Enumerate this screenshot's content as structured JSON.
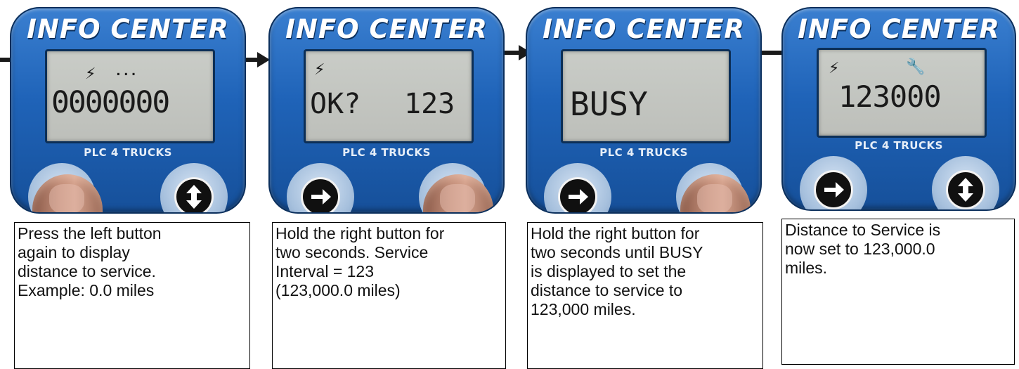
{
  "device": {
    "title": "INFO CENTER",
    "brand": "PLC 4 TRUCKS"
  },
  "colors": {
    "device_body": "#1f63b8",
    "lcd_background": "#c4c6c1",
    "lcd_text": "#1a1a1a",
    "button_core": "#101010",
    "arrow": "#1a1a1a"
  },
  "steps": [
    {
      "lcd": {
        "icon_left": "lightning-icon",
        "icon_right_text": "...",
        "main": "0000000"
      },
      "caption_lines": [
        "Press the left button",
        "again to display",
        "distance to service.",
        "Example:  0.0 miles"
      ],
      "finger_on": "left"
    },
    {
      "lcd": {
        "icon_left": "lightning-icon",
        "left_text": "OK?",
        "right_text": "123"
      },
      "caption_lines": [
        "Hold the right button for",
        "two seconds.  Service",
        "Interval = 123",
        "(123,000.0 miles)"
      ],
      "finger_on": "right"
    },
    {
      "lcd": {
        "main": "BUSY"
      },
      "caption_lines": [
        "Hold the right button for",
        "two seconds until BUSY",
        "is displayed to set the",
        "distance to service to",
        "123,000 miles."
      ],
      "finger_on": "right"
    },
    {
      "lcd": {
        "icon_left": "lightning-icon",
        "icon_right": "wrench-icon",
        "main": "123000"
      },
      "caption_lines": [
        "Distance to Service is",
        "now set to 123,000.0",
        "miles."
      ],
      "finger_on": "none"
    }
  ],
  "icons": {
    "left_button": "right-arrow-icon",
    "right_button": "up-down-arrow-icon"
  }
}
